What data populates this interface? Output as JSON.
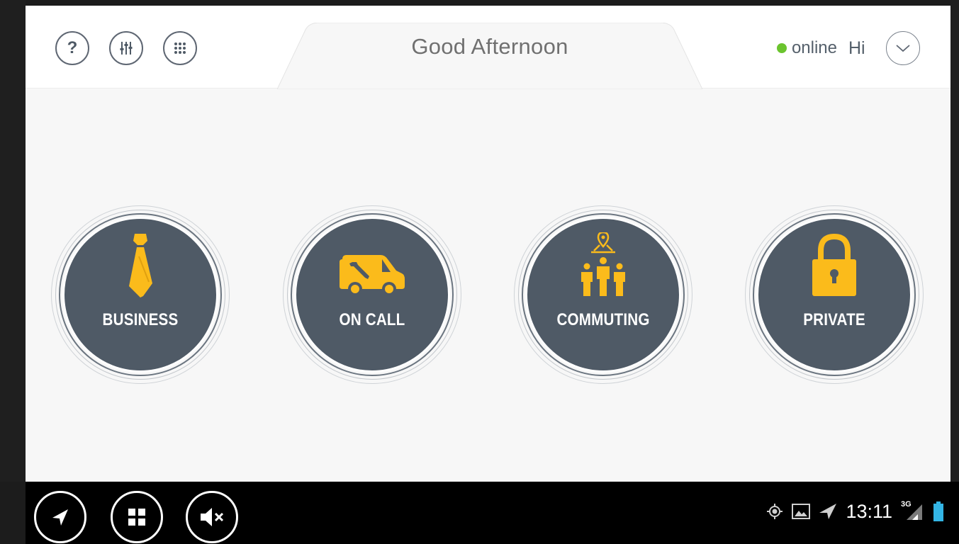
{
  "header": {
    "greeting": "Good Afternoon",
    "status_label": "online",
    "user_greeting": "Hi",
    "status_color": "#6bc42e",
    "icons": [
      "help-icon",
      "equalizer-icon",
      "apps-grid-icon",
      "chevron-down-icon"
    ]
  },
  "modes": [
    {
      "label": "BUSINESS",
      "icon": "tie-icon"
    },
    {
      "label": "ON CALL",
      "icon": "service-van-icon"
    },
    {
      "label": "COMMUTING",
      "icon": "people-location-icon"
    },
    {
      "label": "PRIVATE",
      "icon": "padlock-icon"
    }
  ],
  "colors": {
    "accent": "#fbbb1b",
    "disc": "#4f5a66",
    "background": "#f7f7f7"
  },
  "system_bar": {
    "time": "13:11",
    "network": "3G",
    "buttons": [
      "back-icon",
      "home-icon",
      "mute-icon"
    ],
    "tray_icons": [
      "location-icon",
      "image-icon",
      "navigation-icon",
      "signal-icon",
      "battery-icon"
    ]
  }
}
